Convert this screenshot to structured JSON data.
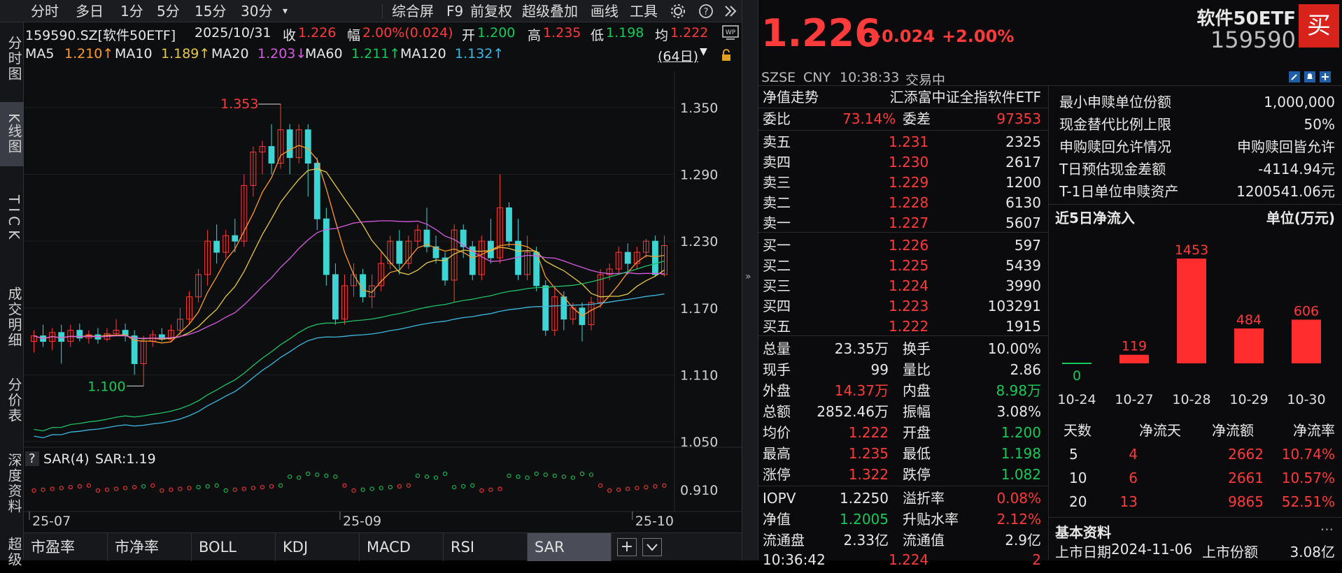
{
  "toolbar": {
    "periods": [
      "分时",
      "多日",
      "1分",
      "5分",
      "15分",
      "30分"
    ],
    "more": "▾",
    "menus": [
      "综合屏",
      "F9",
      "前复权",
      "超级叠加",
      "画线",
      "工具"
    ]
  },
  "side_tabs": [
    "分时图",
    "K线图",
    "TICK",
    "成交明细",
    "分价表",
    "深度资料",
    "超级"
  ],
  "chart": {
    "row1": {
      "code": "159590.SZ[软件50ETF]",
      "date": "2025/10/31",
      "close_label": "收",
      "close": "1.226",
      "amp_label": "幅",
      "amp": "2.00%(0.024)",
      "open_label": "开",
      "open": "1.200",
      "high_label": "高",
      "high": "1.235",
      "low_label": "低",
      "low": "1.198",
      "avg_label": "均",
      "avg": "1.222"
    },
    "row2": {
      "ma5": "MA5",
      "ma5v": "1.210↑",
      "ma10": "MA10",
      "ma10v": "1.189↑",
      "ma20": "MA20",
      "ma20v": "1.203↓",
      "ma60": "MA60",
      "ma60v": "1.211↑",
      "ma120": "MA120",
      "ma120v": "1.132↑",
      "days": "(64日)"
    },
    "price_ticks": [
      "1.350",
      "1.290",
      "1.230",
      "1.170",
      "1.110",
      "1.050"
    ],
    "high_mark": "1.353",
    "low_mark": "1.100",
    "sar_label": "SAR(4)",
    "sar_value": "SAR:1.19",
    "sar_q": "?",
    "sar_tick": "0.910",
    "x_ticks": [
      "25-07",
      "25-09",
      "25-10"
    ],
    "colors": {
      "up": "#ff3b3b",
      "down": "#3fd4d4",
      "ma5": "#ff9a2e",
      "ma10": "#e6c84a",
      "ma20": "#d65be0",
      "ma60": "#22c064",
      "ma120": "#3fb8e0"
    }
  },
  "bottom_tabs": [
    "市盈率",
    "市净率",
    "BOLL",
    "KDJ",
    "MACD",
    "RSI",
    "SAR"
  ],
  "quote": {
    "price": "1.226",
    "change": "+0.024",
    "pct": "+2.00%",
    "name": "软件50ETF",
    "code": "159590",
    "buy_btn": "买",
    "exchange": "SZSE",
    "currency": "CNY",
    "time": "10:38:33",
    "status": "交易中"
  },
  "nav": {
    "label": "净值走势",
    "fund": "汇添富中证全指软件ETF"
  },
  "wb": {
    "wb_label": "委比",
    "wb": "73.14%",
    "wc_label": "委差",
    "wc": "97353"
  },
  "asks": [
    {
      "label": "卖五",
      "price": "1.231",
      "vol": "2325"
    },
    {
      "label": "卖四",
      "price": "1.230",
      "vol": "2617"
    },
    {
      "label": "卖三",
      "price": "1.229",
      "vol": "1200"
    },
    {
      "label": "卖二",
      "price": "1.228",
      "vol": "6130"
    },
    {
      "label": "卖一",
      "price": "1.227",
      "vol": "5607"
    }
  ],
  "bids": [
    {
      "label": "买一",
      "price": "1.226",
      "vol": "597"
    },
    {
      "label": "买二",
      "price": "1.225",
      "vol": "5439"
    },
    {
      "label": "买三",
      "price": "1.224",
      "vol": "3990"
    },
    {
      "label": "买四",
      "price": "1.223",
      "vol": "103291"
    },
    {
      "label": "买五",
      "price": "1.222",
      "vol": "1915"
    }
  ],
  "stats": [
    {
      "l1": "总量",
      "v1": "23.35万",
      "l2": "换手",
      "v2": "10.00%",
      "c1": "white",
      "c2": "white"
    },
    {
      "l1": "现手",
      "v1": "99",
      "l2": "量比",
      "v2": "2.86",
      "c1": "white",
      "c2": "white"
    },
    {
      "l1": "外盘",
      "v1": "14.37万",
      "l2": "内盘",
      "v2": "8.98万",
      "c1": "red",
      "c2": "green"
    },
    {
      "l1": "总额",
      "v1": "2852.46万",
      "l2": "振幅",
      "v2": "3.08%",
      "c1": "white",
      "c2": "white"
    },
    {
      "l1": "均价",
      "v1": "1.222",
      "l2": "开盘",
      "v2": "1.200",
      "c1": "red",
      "c2": "green"
    },
    {
      "l1": "最高",
      "v1": "1.235",
      "l2": "最低",
      "v2": "1.198",
      "c1": "red",
      "c2": "green"
    },
    {
      "l1": "涨停",
      "v1": "1.322",
      "l2": "跌停",
      "v2": "1.082",
      "c1": "red",
      "c2": "green"
    },
    {
      "l1": "IOPV",
      "v1": "1.2250",
      "l2": "溢折率",
      "v2": "0.08%",
      "c1": "white",
      "c2": "red"
    },
    {
      "l1": "净值",
      "v1": "1.2005",
      "l2": "升贴水率",
      "v2": "2.12%",
      "c1": "green",
      "c2": "red"
    },
    {
      "l1": "流通盘",
      "v1": "2.33亿",
      "l2": "流通值",
      "v2": "2.9亿",
      "c1": "white",
      "c2": "white"
    }
  ],
  "last_trade": {
    "time": "10:36:42",
    "price": "1.224",
    "vol": "2"
  },
  "fund_info": [
    {
      "label": "最小申赎单位份额",
      "value": "1,000,000"
    },
    {
      "label": "现金替代比例上限",
      "value": "50%"
    },
    {
      "label": "申购赎回允许情况",
      "value": "申购赎回皆允许"
    },
    {
      "label": "T日预估现金差额",
      "value": "-4114.94元"
    },
    {
      "label": "T-1日单位申赎资产",
      "value": "1200541.06元"
    }
  ],
  "flow": {
    "title": "近5日净流入",
    "unit": "单位(万元)"
  },
  "chart_data": {
    "type": "bar",
    "categories": [
      "10-24",
      "10-27",
      "10-28",
      "10-29",
      "10-30"
    ],
    "values": [
      0,
      119,
      1453,
      484,
      606
    ],
    "title": "近5日净流入",
    "ylabel": "单位(万元)"
  },
  "flow_table": {
    "headers": [
      "天数",
      "净流天",
      "净流额",
      "净流率"
    ],
    "rows": [
      [
        "5",
        "4",
        "2662",
        "10.74%"
      ],
      [
        "10",
        "6",
        "2661",
        "10.57%"
      ],
      [
        "20",
        "13",
        "9865",
        "52.51%"
      ]
    ]
  },
  "basic": {
    "title": "基本资料",
    "more": "...",
    "list_label": "上市日期",
    "list_date": "2024-11-06",
    "shares_label": "上市份额",
    "shares": "3.08亿"
  }
}
